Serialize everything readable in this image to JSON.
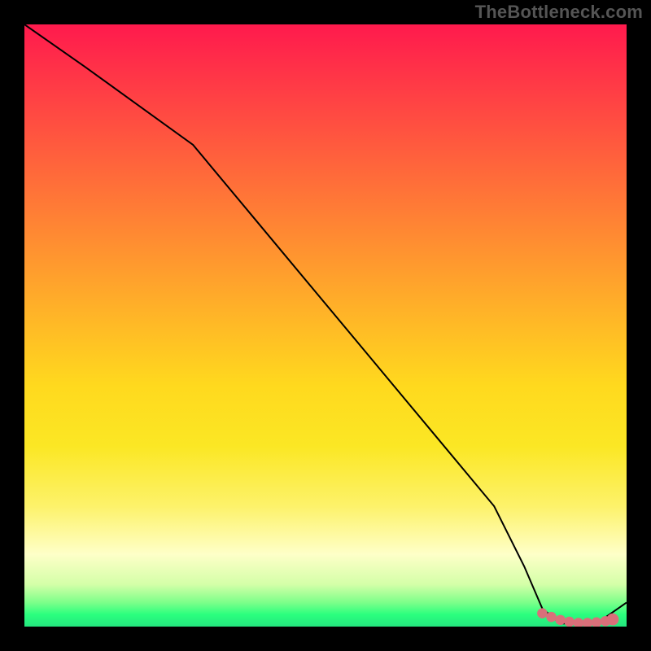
{
  "watermark_text": "TheBottleneck.com",
  "chart_data": {
    "type": "line",
    "title": "",
    "xlabel": "",
    "ylabel": "",
    "xlim": [
      0,
      100
    ],
    "ylim": [
      0,
      100
    ],
    "series": [
      {
        "name": "bottleneck-curve",
        "x": [
          0,
          10,
          28,
          38,
          48,
          58,
          68,
          78,
          83,
          86,
          89,
          92,
          95,
          100
        ],
        "y": [
          100,
          93,
          80,
          68,
          56,
          44,
          32,
          20,
          10,
          3,
          0.5,
          0.5,
          0.5,
          4
        ]
      }
    ],
    "highlight_points": {
      "name": "optimal-range-dots",
      "color": "#d9707a",
      "points": [
        {
          "x": 86,
          "y": 2.2
        },
        {
          "x": 87.5,
          "y": 1.6
        },
        {
          "x": 89,
          "y": 1.1
        },
        {
          "x": 90.5,
          "y": 0.8
        },
        {
          "x": 92,
          "y": 0.6
        },
        {
          "x": 93.5,
          "y": 0.6
        },
        {
          "x": 95,
          "y": 0.7
        },
        {
          "x": 96.5,
          "y": 0.9
        }
      ]
    },
    "background_gradient": {
      "top": "#ff1a4d",
      "mid": "#ffd91e",
      "bottom": "#24e67e"
    },
    "grid": false
  }
}
